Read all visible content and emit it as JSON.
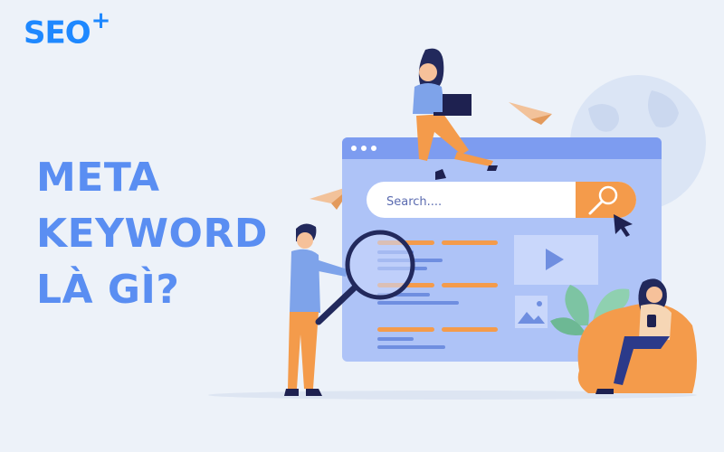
{
  "brand": {
    "logo_text": "SEO",
    "logo_plus": "+"
  },
  "headline": {
    "line1": "META",
    "line2": "KEYWORD",
    "line3": "LÀ GÌ?"
  },
  "browser": {
    "search_placeholder": "Search...."
  },
  "icons": {
    "search": "magnifier-icon",
    "play": "play-icon",
    "image": "image-icon",
    "cursor": "cursor-arrow-icon",
    "globe": "globe-icon",
    "paper_plane": "paper-plane-icon"
  },
  "colors": {
    "background": "#edf2f9",
    "headline": "#5a8ef2",
    "logo": "#1e88ff",
    "browser_frame": "#7d9cf0",
    "browser_body": "#aec3f7",
    "accent_orange": "#f49b4b",
    "person_blue": "#7ea3ea",
    "navy": "#243066"
  }
}
